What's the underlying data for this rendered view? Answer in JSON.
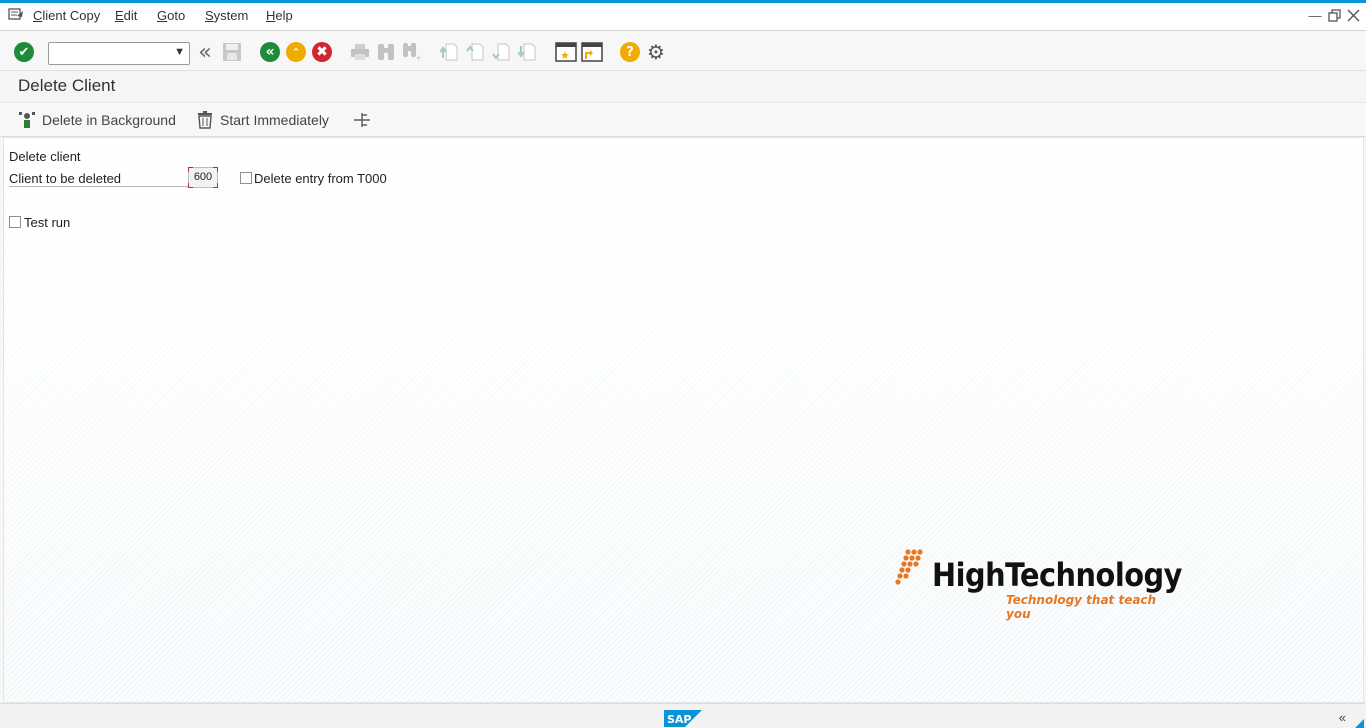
{
  "menubar": {
    "items": [
      {
        "label": "Client Copy",
        "mnemonic": "C"
      },
      {
        "label": "Edit",
        "mnemonic": "E"
      },
      {
        "label": "Goto",
        "mnemonic": "G"
      },
      {
        "label": "System",
        "mnemonic": "S"
      },
      {
        "label": "Help",
        "mnemonic": "H"
      }
    ]
  },
  "toolbar": {
    "command_field_value": "",
    "icons": [
      "enter-icon",
      "back-double-icon",
      "save-icon",
      "back-icon",
      "exit-icon",
      "cancel-icon",
      "print-icon",
      "find-icon",
      "find-next-icon",
      "first-page-icon",
      "previous-page-icon",
      "next-page-icon",
      "last-page-icon",
      "create-session-icon",
      "shortcut-icon",
      "help-icon",
      "customize-icon"
    ]
  },
  "title": "Delete Client",
  "app_toolbar": {
    "delete_background": "Delete in Background",
    "start_immediately": "Start Immediately"
  },
  "form": {
    "section_label": "Delete client",
    "client_label": "Client to be deleted",
    "client_value": "600",
    "delete_entry_label": "Delete entry from T000",
    "delete_entry_checked": false,
    "test_run_label": "Test run",
    "test_run_checked": false
  },
  "watermark": {
    "name": "HighTechnology",
    "tagline": "Technology that teach you"
  },
  "footer": {
    "logo_text": "SAP",
    "collapse_glyph": "«"
  },
  "colors": {
    "accent": "#0a93d6",
    "enter_green": "#1e8b3a",
    "back_green": "#1e8b3a",
    "exit_orange": "#f0ab00",
    "cancel_red": "#d0262f",
    "help_yellow": "#f0ab00",
    "logo_orange": "#e87722"
  }
}
